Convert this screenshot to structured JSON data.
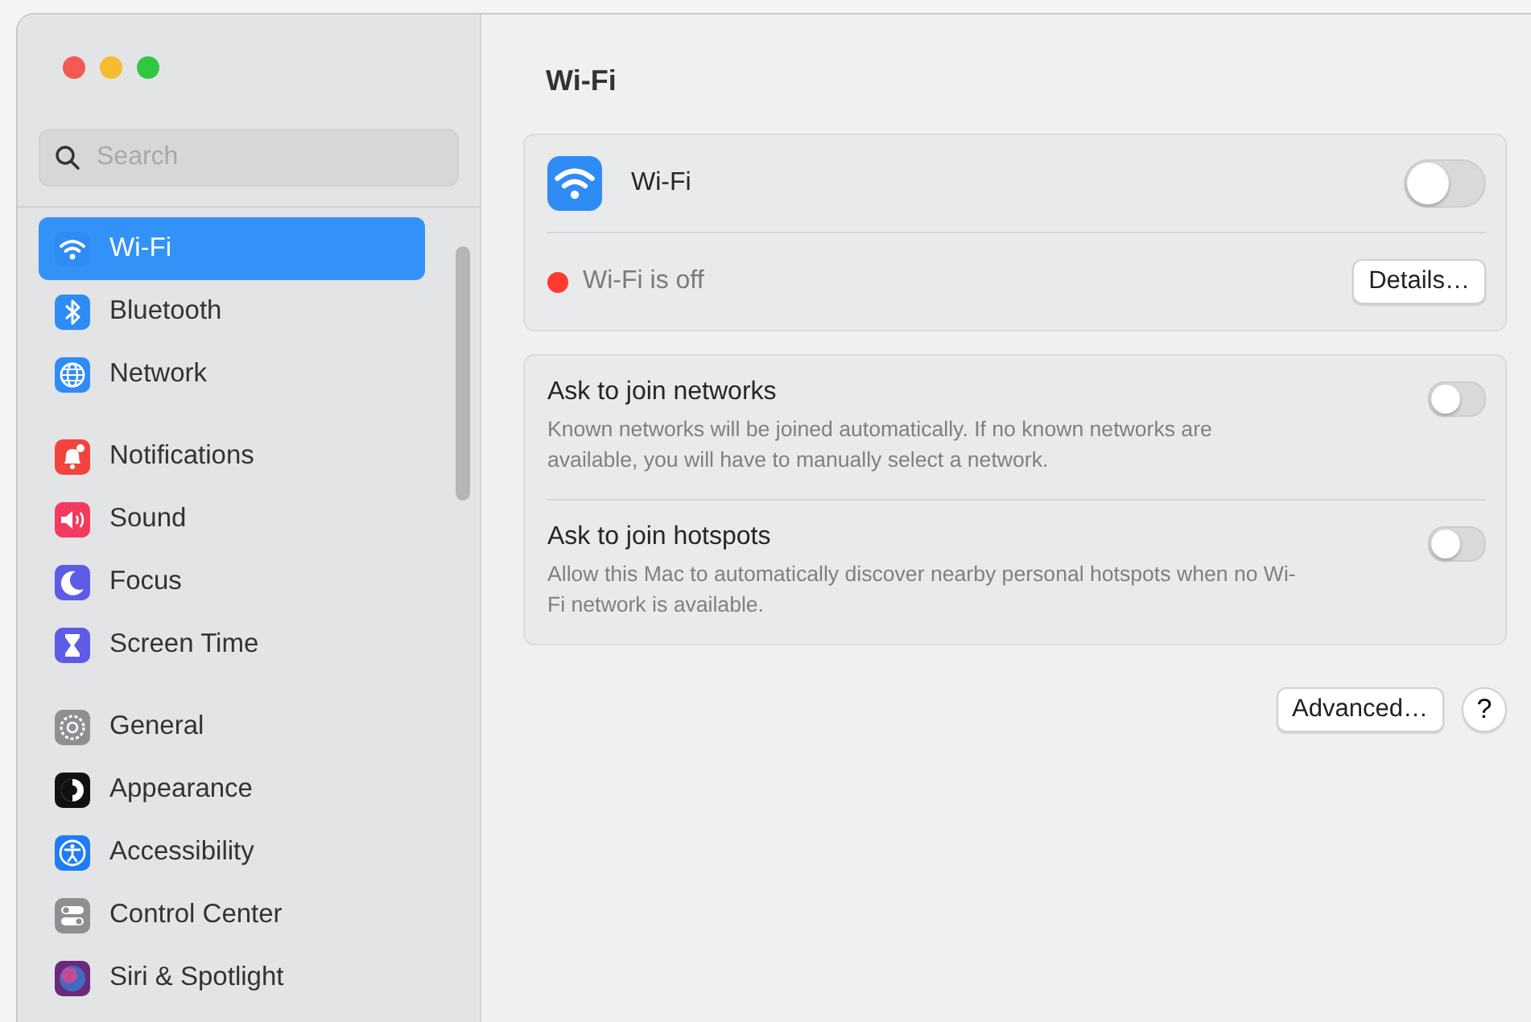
{
  "window": {
    "title": "Wi-Fi"
  },
  "search": {
    "placeholder": "Search"
  },
  "sidebar": {
    "groups": [
      {
        "items": [
          {
            "label": "Wi-Fi",
            "kind": "wifi",
            "selected": true
          },
          {
            "label": "Bluetooth",
            "kind": "bluetooth",
            "selected": false
          },
          {
            "label": "Network",
            "kind": "globe",
            "selected": false
          }
        ]
      },
      {
        "items": [
          {
            "label": "Notifications",
            "kind": "bell",
            "selected": false
          },
          {
            "label": "Sound",
            "kind": "speaker",
            "selected": false
          },
          {
            "label": "Focus",
            "kind": "moon",
            "selected": false
          },
          {
            "label": "Screen Time",
            "kind": "hourglass",
            "selected": false
          }
        ]
      },
      {
        "items": [
          {
            "label": "General",
            "kind": "gear",
            "selected": false
          },
          {
            "label": "Appearance",
            "kind": "appearance",
            "selected": false
          },
          {
            "label": "Accessibility",
            "kind": "accessibility",
            "selected": false
          },
          {
            "label": "Control Center",
            "kind": "switches",
            "selected": false
          },
          {
            "label": "Siri & Spotlight",
            "kind": "siri",
            "selected": false
          }
        ]
      }
    ]
  },
  "wifi": {
    "label": "Wi-Fi",
    "on": false,
    "status": "Wi-Fi is off",
    "details_button": "Details…"
  },
  "options": [
    {
      "title": "Ask to join networks",
      "description": "Known networks will be joined automatically. If no known networks are available, you will have to manually select a network.",
      "on": false
    },
    {
      "title": "Ask to join hotspots",
      "description": "Allow this Mac to automatically discover nearby personal hotspots when no Wi-Fi network is available.",
      "on": false
    }
  ],
  "buttons": {
    "advanced": "Advanced…",
    "help": "?"
  }
}
